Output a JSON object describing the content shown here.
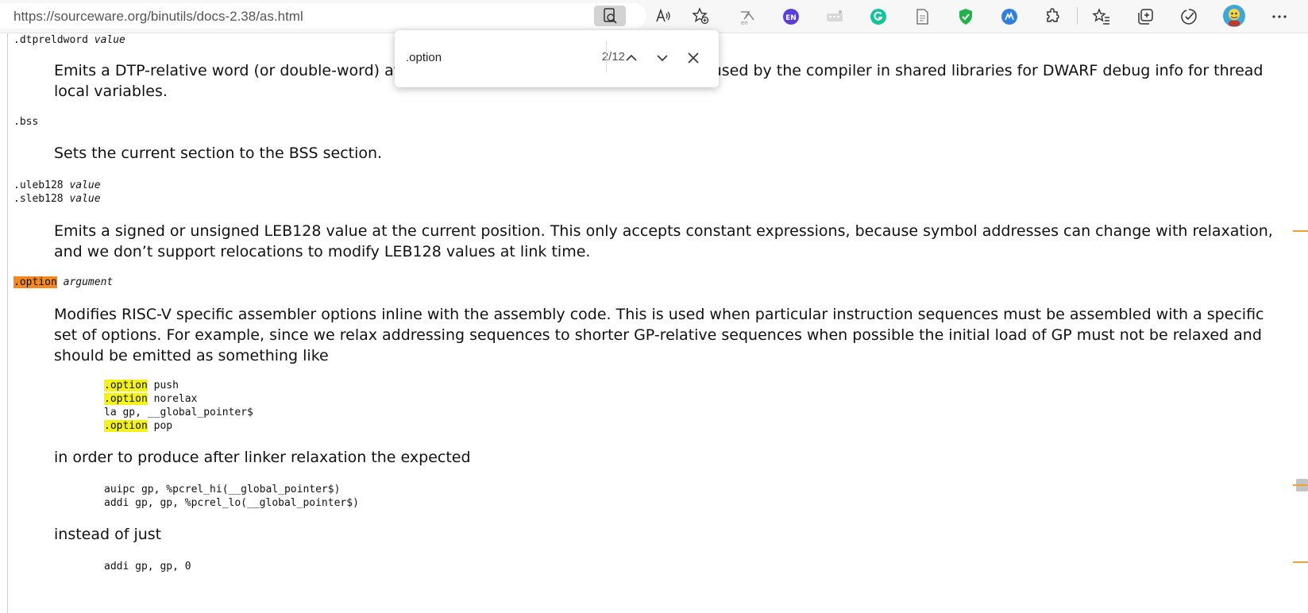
{
  "browser": {
    "address": "https://sourceware.org/binutils/docs-2.38/as.html",
    "extension_badge": "EN",
    "icons": [
      "find-on-page-icon",
      "read-aloud-icon",
      "add-favorite-icon",
      "translate-extension-icon",
      "language-extension-icon",
      "keyboard-extension-icon",
      "grammarly-icon",
      "page-icon",
      "shield-extension-icon",
      "cloud-extension-icon",
      "extensions-icon",
      "favorites-icon",
      "collections-icon",
      "browser-essentials-icon",
      "profile-avatar",
      "more-menu-icon"
    ]
  },
  "find": {
    "query": ".option",
    "count": "2/12"
  },
  "doc": {
    "dtpreldword_cmd": ".dtpreldword",
    "dtpreldword_arg": "value",
    "dtpreldword_desc": "Emits a DTP-relative word (or double-word) at the current position. This is meant to be used by the compiler in shared libraries for DWARF debug info for thread local variables.",
    "bss_cmd": ".bss",
    "bss_desc": "Sets the current section to the BSS section.",
    "uleb_cmd": ".uleb128",
    "uleb_arg": "value",
    "sleb_cmd": ".sleb128",
    "sleb_arg": "value",
    "leb_desc": "Emits a signed or unsigned LEB128 value at the current position. This only accepts constant expressions, because symbol addresses can change with relaxation, and we don’t support relocations to modify LEB128 values at link time.",
    "option_cmd": ".option",
    "option_arg": "argument",
    "option_desc": "Modifies RISC-V specific assembler options inline with the assembly code. This is used when particular instruction sequences must be assembled with a specific set of options. For example, since we relax addressing sequences to shorter GP-relative sequences when possible the initial load of GP must not be relaxed and should be emitted as something like",
    "code1": [
      {
        "hl": ".option",
        "rest": " push"
      },
      {
        "hl": ".option",
        "rest": " norelax"
      },
      {
        "hl": "",
        "rest": "la gp, __global_pointer$"
      },
      {
        "hl": ".option",
        "rest": " pop"
      }
    ],
    "after_text": "in order to produce after linker relaxation the expected",
    "code2": [
      "auipc gp, %pcrel_hi(__global_pointer$)",
      "addi gp, gp, %pcrel_lo(__global_pointer$)"
    ],
    "instead_text": "instead of just",
    "code3": [
      "addi gp, gp, 0"
    ]
  },
  "colors": {
    "active_match": "#f3891f",
    "match": "#f4f216",
    "scroll_marker": "#f0a235"
  }
}
